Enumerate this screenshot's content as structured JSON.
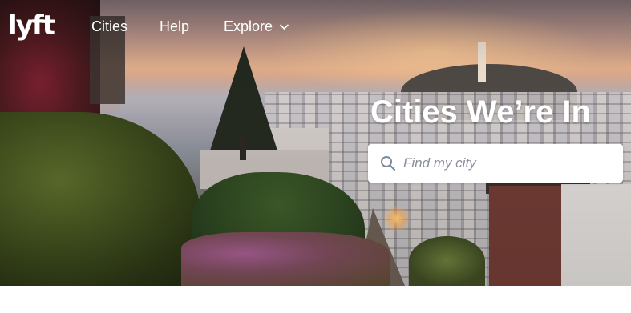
{
  "header": {
    "logo_text": "lyft",
    "nav": {
      "cities": "Cities",
      "help": "Help",
      "explore": "Explore"
    }
  },
  "hero": {
    "title": "Cities We’re In",
    "search": {
      "placeholder": "Find my city",
      "value": ""
    }
  },
  "icons": {
    "search": "search-icon",
    "explore_dropdown": "chevron-down-icon"
  },
  "colors": {
    "header_text": "#ffffff",
    "search_background": "#ffffff",
    "search_icon": "#7c8a9c",
    "placeholder": "#8a8f9c"
  }
}
